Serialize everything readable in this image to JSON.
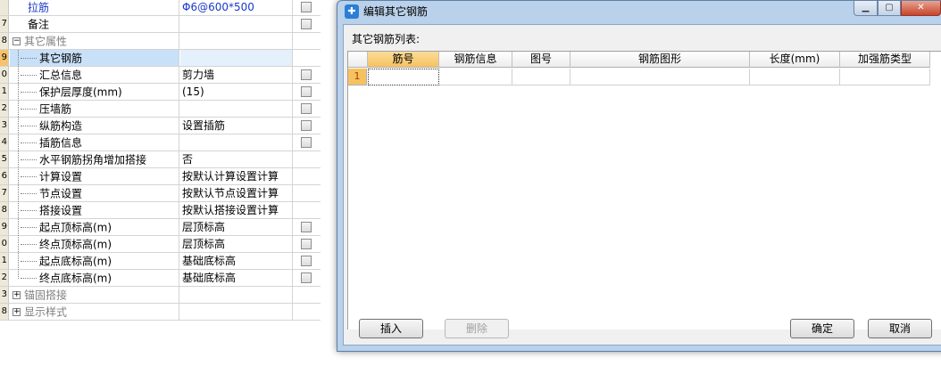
{
  "property_grid": {
    "rows": [
      {
        "num": "",
        "name": "拉筋",
        "value": "Φ6@600*500",
        "checkbox": true,
        "style": "blue"
      },
      {
        "num": "7",
        "name": "备注",
        "value": "",
        "checkbox": true,
        "style": ""
      },
      {
        "num": "8",
        "name": "其它属性",
        "value": "",
        "checkbox": false,
        "style": "gray",
        "toggle": "−"
      },
      {
        "num": "9",
        "name": "其它钢筋",
        "value": "",
        "checkbox": false,
        "style": "sel"
      },
      {
        "num": "0",
        "name": "汇总信息",
        "value": "剪力墙",
        "checkbox": true,
        "style": ""
      },
      {
        "num": "1",
        "name": "保护层厚度(mm)",
        "value": "(15)",
        "checkbox": true,
        "style": ""
      },
      {
        "num": "2",
        "name": "压墙筋",
        "value": "",
        "checkbox": true,
        "style": ""
      },
      {
        "num": "3",
        "name": "纵筋构造",
        "value": "设置插筋",
        "checkbox": true,
        "style": ""
      },
      {
        "num": "4",
        "name": "插筋信息",
        "value": "",
        "checkbox": true,
        "style": ""
      },
      {
        "num": "5",
        "name": "水平钢筋拐角增加搭接",
        "value": "否",
        "checkbox": false,
        "style": ""
      },
      {
        "num": "6",
        "name": "计算设置",
        "value": "按默认计算设置计算",
        "checkbox": false,
        "style": ""
      },
      {
        "num": "7",
        "name": "节点设置",
        "value": "按默认节点设置计算",
        "checkbox": false,
        "style": ""
      },
      {
        "num": "8",
        "name": "搭接设置",
        "value": "按默认搭接设置计算",
        "checkbox": false,
        "style": ""
      },
      {
        "num": "9",
        "name": "起点顶标高(m)",
        "value": "层顶标高",
        "checkbox": true,
        "style": ""
      },
      {
        "num": "0",
        "name": "终点顶标高(m)",
        "value": "层顶标高",
        "checkbox": true,
        "style": ""
      },
      {
        "num": "1",
        "name": "起点底标高(m)",
        "value": "基础底标高",
        "checkbox": true,
        "style": ""
      },
      {
        "num": "2",
        "name": "终点底标高(m)",
        "value": "基础底标高",
        "checkbox": true,
        "style": ""
      },
      {
        "num": "3",
        "name": "锚固搭接",
        "value": "",
        "checkbox": false,
        "style": "gray",
        "toggle": "+"
      },
      {
        "num": "8",
        "name": "显示样式",
        "value": "",
        "checkbox": false,
        "style": "gray",
        "toggle": "+"
      }
    ]
  },
  "dialog": {
    "title": "编辑其它钢筋",
    "app_icon": "app-logo-icon",
    "list_label": "其它钢筋列表:",
    "columns": [
      "筋号",
      "钢筋信息",
      "图号",
      "钢筋图形",
      "长度(mm)",
      "加强筋类型"
    ],
    "row_number": "1",
    "buttons": {
      "insert": "插入",
      "delete": "删除",
      "ok": "确定",
      "cancel": "取消"
    },
    "window_controls": {
      "minimize": "▁",
      "maximize": "▢",
      "close": "✕"
    }
  }
}
